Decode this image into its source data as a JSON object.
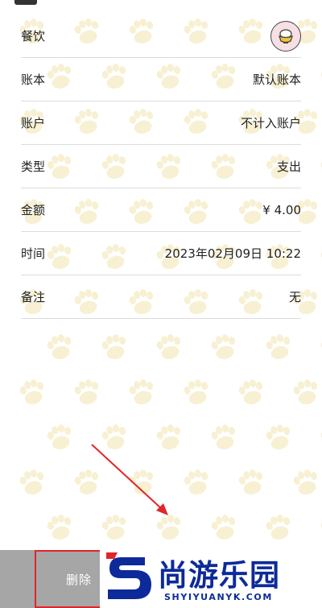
{
  "details": [
    {
      "label": "餐饮",
      "value": "",
      "icon": "rice-bowl-icon"
    },
    {
      "label": "账本",
      "value": "默认账本"
    },
    {
      "label": "账户",
      "value": "不计入账户"
    },
    {
      "label": "类型",
      "value": "支出"
    },
    {
      "label": "金额",
      "value": "¥ 4.00"
    },
    {
      "label": "时间",
      "value": "2023年02月09日 10:22"
    },
    {
      "label": "备注",
      "value": "无"
    }
  ],
  "bottom": {
    "delete_label": "删除"
  },
  "watermark": {
    "brand": "尚游乐园",
    "url": "SHYIYUANYK.COM"
  },
  "colors": {
    "annotation_red": "#e0262a",
    "paw_pattern": "#f7f0d2",
    "watermark_blue": "#0d2a9a",
    "bottom_bar": "#a6a6a6"
  }
}
